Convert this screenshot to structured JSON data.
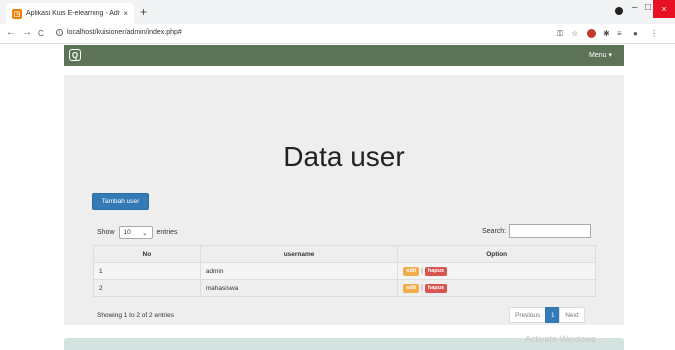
{
  "browser": {
    "tab_title": "Aplikasi Kuis E-elearning - Admin",
    "tab_close": "×",
    "new_tab": "+",
    "url": "localhost/kuisioner/admin/index.php#",
    "back": "←",
    "forward": "→",
    "reload": "C",
    "win_min": "–",
    "win_max": "□",
    "win_close": "×"
  },
  "navbar": {
    "brand": "Q",
    "menu_label": "Menu ▾"
  },
  "main": {
    "heading": "Data user",
    "add_button": "Tambah user",
    "show_label": "Show",
    "entries_value": "10",
    "entries_label": "entries",
    "search_label": "Search:",
    "search_value": ""
  },
  "table": {
    "headers": [
      "No",
      "username",
      "Option"
    ],
    "rows": [
      {
        "no": "1",
        "username": "admin",
        "edit": "edit",
        "sep": "|",
        "hapus": "hapus"
      },
      {
        "no": "2",
        "username": "mahasiswa",
        "edit": "edit",
        "sep": "|",
        "hapus": "hapus"
      }
    ]
  },
  "footer": {
    "info": "Showing 1 to 2 of 2 entries",
    "prev": "Previous",
    "page": "1",
    "next": "Next"
  },
  "watermark": "Activate Windows",
  "colors": {
    "navbar": "#5d7358",
    "primary": "#337ab7",
    "warning": "#f0ad4e",
    "danger": "#d9534f"
  }
}
